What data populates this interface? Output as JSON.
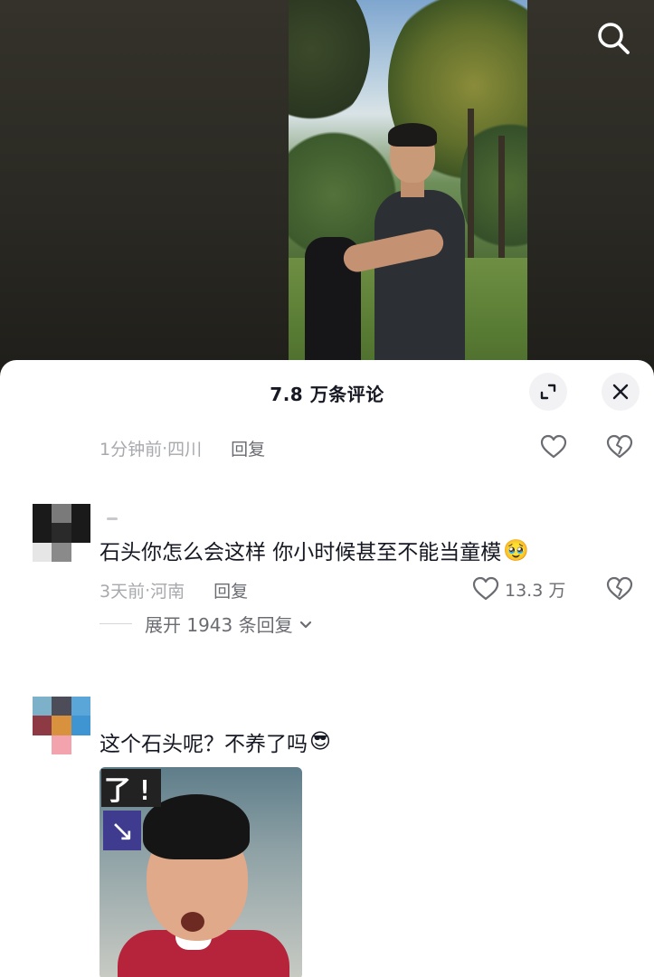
{
  "video": {
    "search_icon": "search-icon"
  },
  "comments_panel": {
    "title": "7.8 万条评论",
    "expand_icon": "expand-icon",
    "close_icon": "close-icon",
    "previous_comment": {
      "time": "1分钟前",
      "separator": " · ",
      "location": "四川",
      "reply_label": "回复"
    },
    "comments": [
      {
        "avatar_colors": [
          "#1a1a1a",
          "#7a7a7a",
          "#1a1a1a",
          "#1a1a1a",
          "#2a2a2a",
          "#1a1a1a",
          "#e6e6e6",
          "#8a8a8a",
          "#ffffff"
        ],
        "text": "石头你怎么会这样 你小时候甚至不能当童模",
        "emoji": "🥹",
        "time": "3天前",
        "separator": " · ",
        "location": "河南",
        "reply_label": "回复",
        "like_count": "13.3 万",
        "expand_replies": "展开 1943 条回复"
      },
      {
        "avatar_colors": [
          "#7db0c9",
          "#4d4d5a",
          "#5aa6d8",
          "#8e3a44",
          "#d8923e",
          "#3e95d2",
          "#ffffff",
          "#f3a3ad",
          "#ffffff"
        ],
        "text": "这个石头呢？不养了吗",
        "emoji": "😎",
        "sticker_text": "了!",
        "sticker_arrow": "↘"
      }
    ]
  },
  "colors": {
    "primary_text": "#161823",
    "secondary_text": "#a8a9ad",
    "action_text": "#6b6c72",
    "sheet_bg": "#ffffff"
  }
}
